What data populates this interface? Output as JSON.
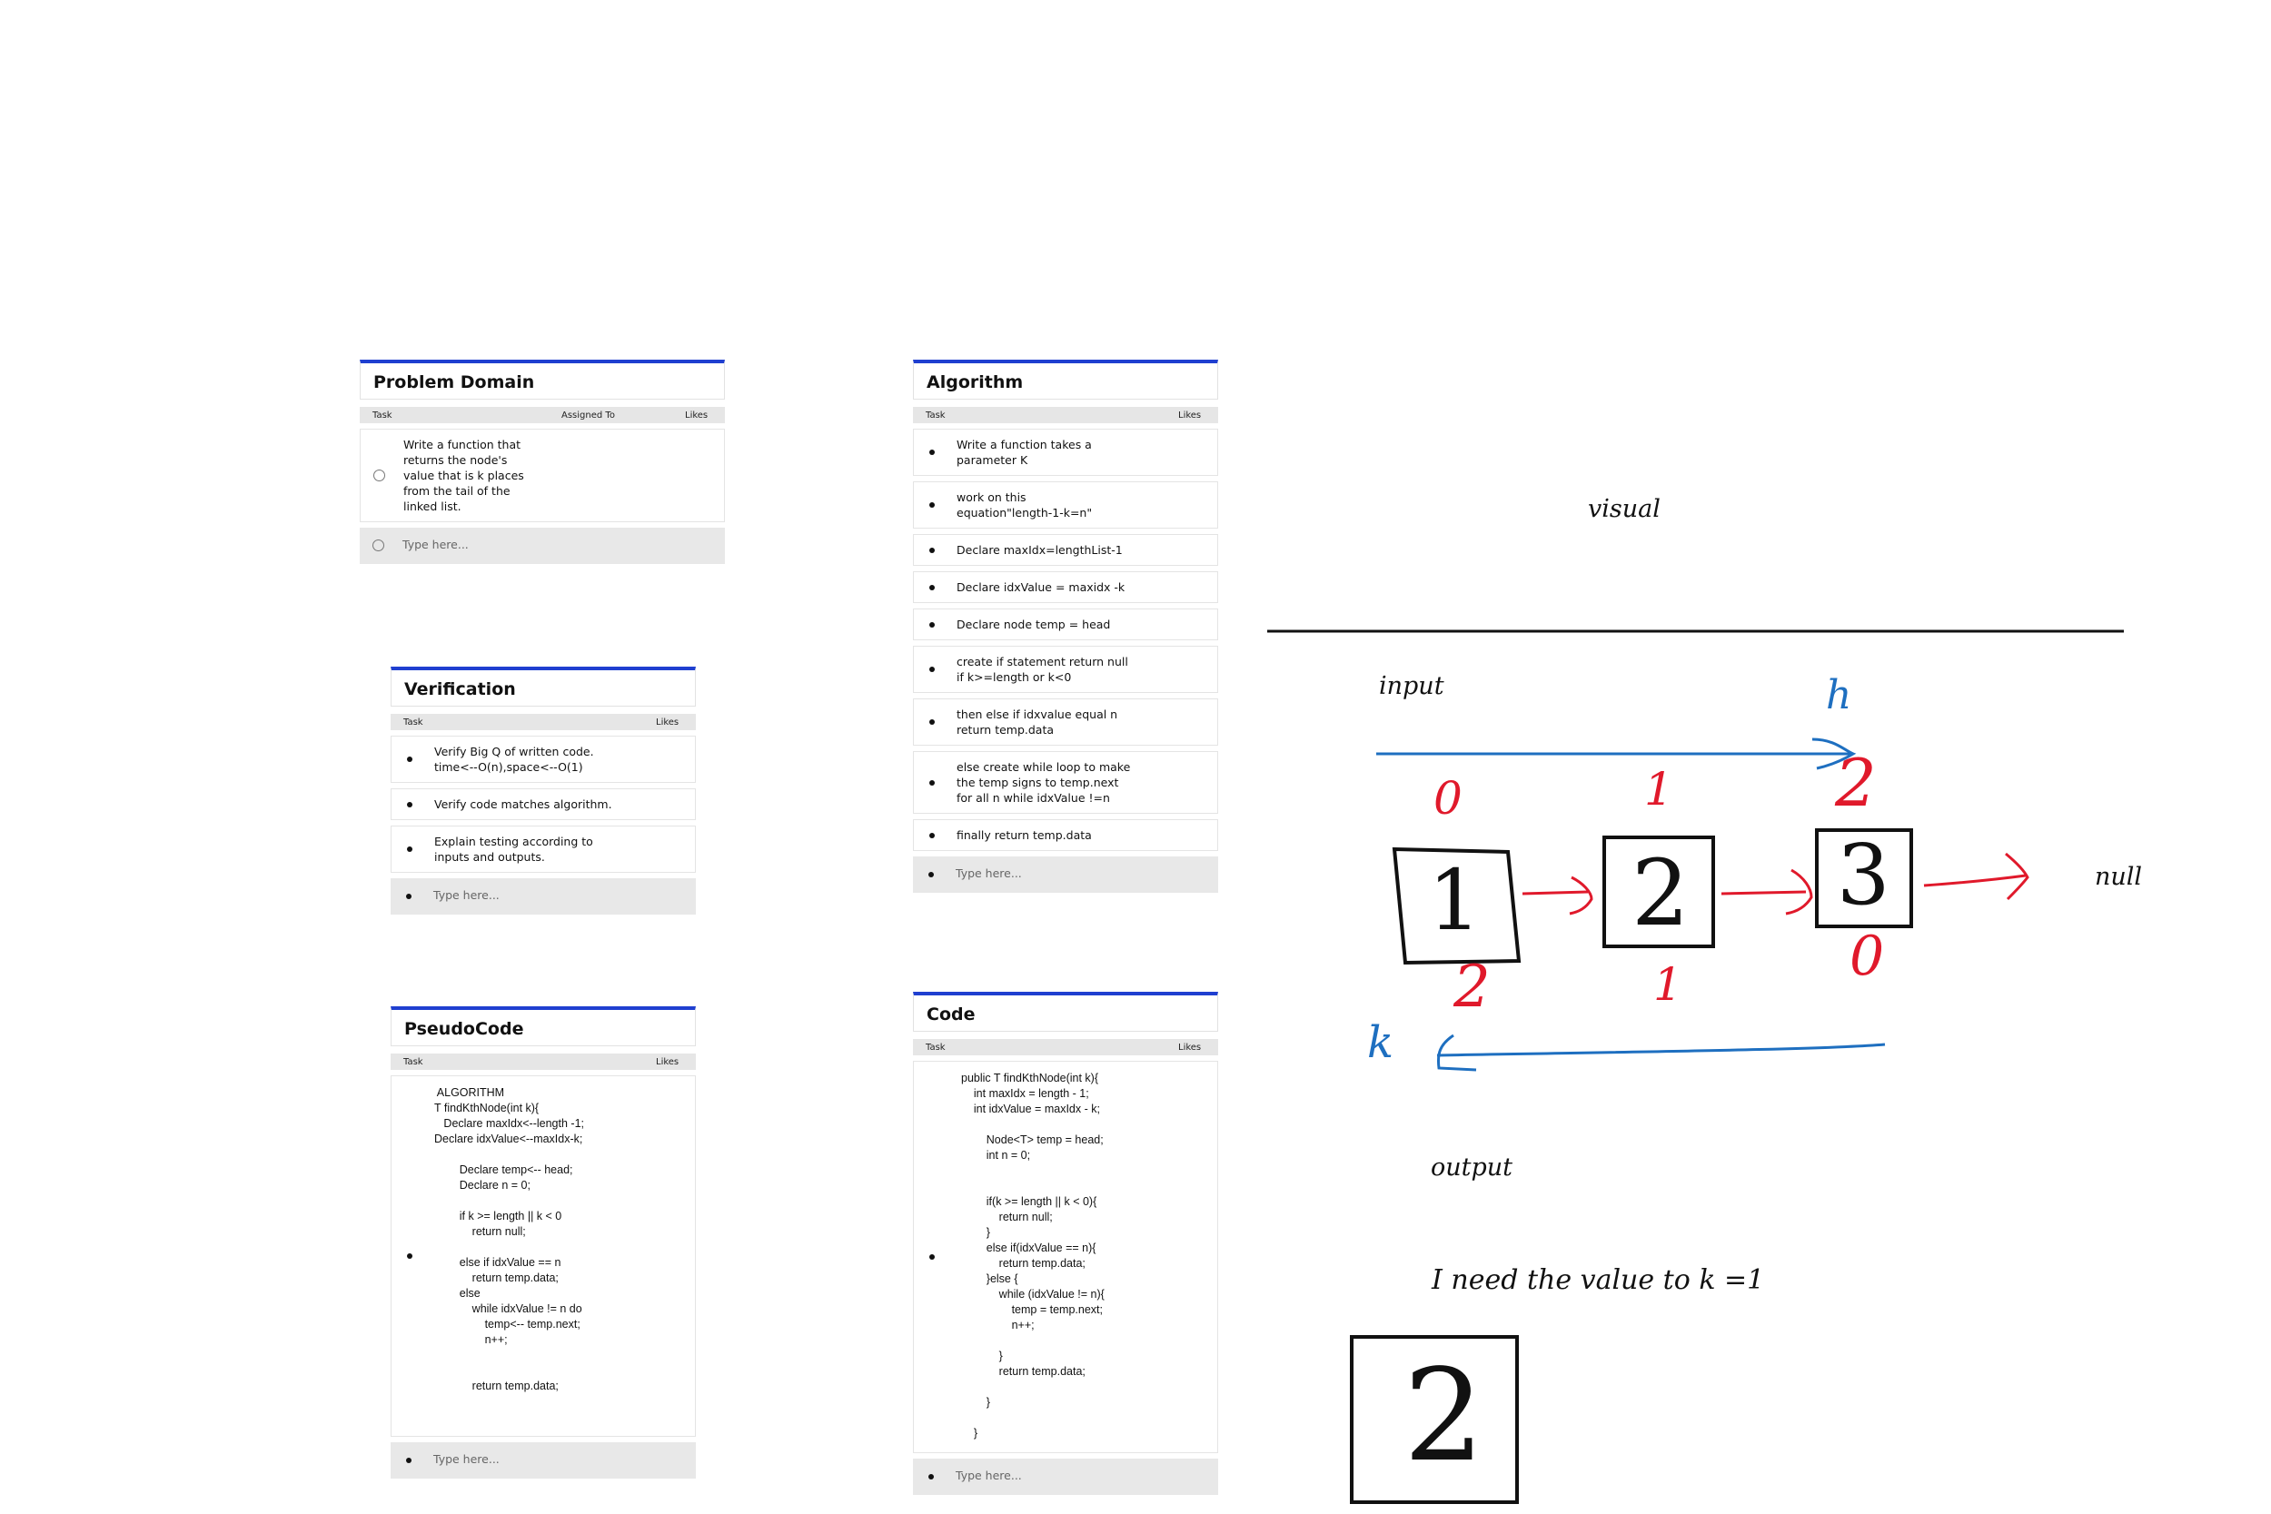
{
  "problem_domain": {
    "title": "Problem Domain",
    "columns": [
      "Task",
      "Assigned To",
      "Likes"
    ],
    "items": [
      "Write a function that\nreturns the node's\nvalue that is k places\nfrom the tail of the\nlinked list."
    ],
    "placeholder": "Type here..."
  },
  "verification": {
    "title": "Verification",
    "columns": [
      "Task",
      "Likes"
    ],
    "items": [
      "Verify Big Q of written code.\ntime<--O(n),space<--O(1)",
      "Verify code matches algorithm.",
      "Explain testing according to\ninputs and outputs."
    ],
    "placeholder": "Type here..."
  },
  "pseudocode": {
    "title": "PseudoCode",
    "columns": [
      "Task",
      "Likes"
    ],
    "code": " ALGORITHM\nT findKthNode(int k){\n   Declare maxIdx<--length -1;\nDeclare idxValue<--maxIdx-k;\n\n        Declare temp<-- head;\n        Declare n = 0;\n\n        if k >= length || k < 0\n            return null;\n\n        else if idxValue == n\n            return temp.data;\n        else\n            while idxValue != n do\n                temp<-- temp.next;\n                n++;\n\n\n            return temp.data;",
    "placeholder": "Type here..."
  },
  "algorithm": {
    "title": "Algorithm",
    "columns": [
      "Task",
      "Likes"
    ],
    "items": [
      "Write a function takes a\nparameter K",
      "work on this\nequation\"length-1-k=n\"",
      "Declare maxIdx=lengthList-1",
      "Declare idxValue = maxidx -k",
      "Declare node temp = head",
      "create if statement return null\nif k>=length or k<0",
      "then else if idxvalue equal n\nreturn temp.data",
      "else create while loop to make\nthe temp signs to temp.next\nfor all n while idxValue !=n",
      "finally return temp.data"
    ],
    "placeholder": "Type here..."
  },
  "code": {
    "title": "Code",
    "columns": [
      "Task",
      "Likes"
    ],
    "code": "public T findKthNode(int k){\n    int maxIdx = length - 1;\n    int idxValue = maxIdx - k;\n\n        Node<T> temp = head;\n        int n = 0;\n\n\n        if(k >= length || k < 0){\n            return null;\n        }\n        else if(idxValue == n){\n            return temp.data;\n        }else {\n            while (idxValue != n){\n                temp = temp.next;\n                n++;\n\n            }\n            return temp.data;\n\n        }\n\n    }",
    "placeholder": "Type here..."
  },
  "sketch": {
    "title": "visual",
    "input_label": "input",
    "output_label": "output",
    "null_label": "null",
    "head_label": "h",
    "k_label": "k",
    "nodes": [
      "1",
      "2",
      "3"
    ],
    "top_indices": [
      "0",
      "1",
      "2"
    ],
    "bottom_indices": [
      "2",
      "1",
      "0"
    ],
    "note": "I need the value to k =1",
    "result": "2",
    "colors": {
      "red": "#e0192b",
      "blue": "#1e6fc0",
      "black": "#111111"
    }
  }
}
